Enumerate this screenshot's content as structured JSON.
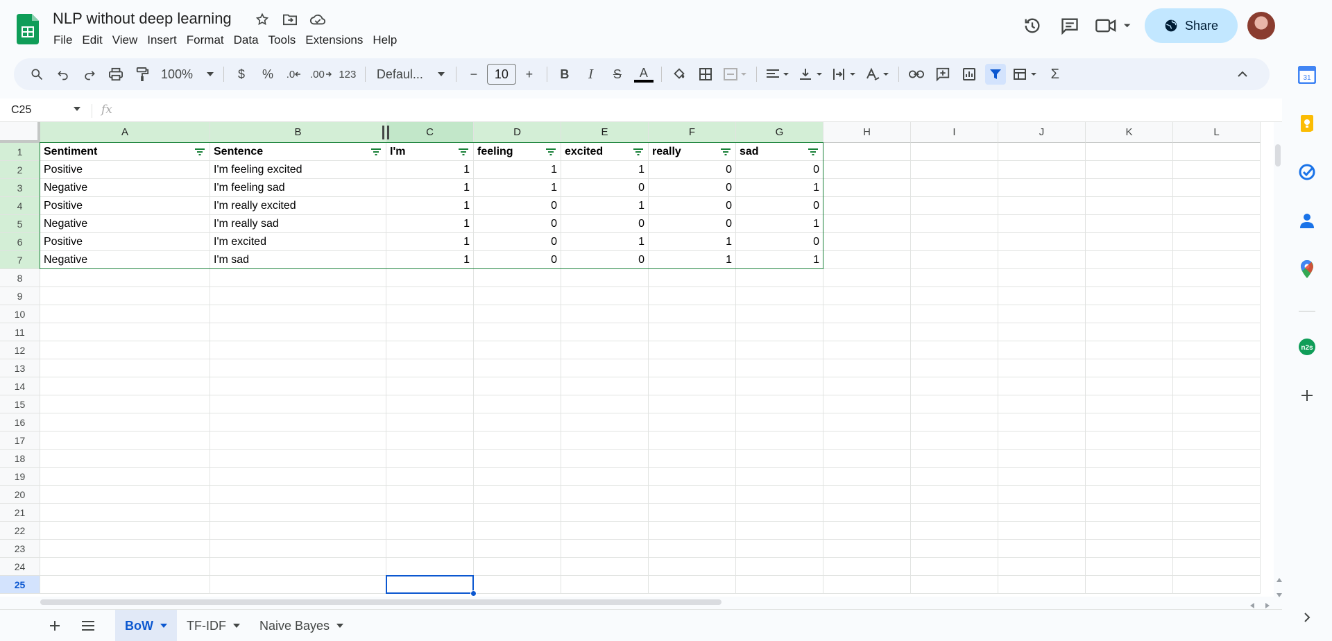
{
  "document": {
    "title": "NLP without deep learning"
  },
  "menu": [
    "File",
    "Edit",
    "View",
    "Insert",
    "Format",
    "Data",
    "Tools",
    "Extensions",
    "Help"
  ],
  "header": {
    "share_label": "Share"
  },
  "toolbar": {
    "zoom": "100%",
    "currency": "$",
    "percent": "%",
    "decrease_decimal": ".0",
    "increase_decimal": ".00",
    "number_format": "123",
    "font": "Defaul...",
    "font_size": "10",
    "minus": "−",
    "plus": "+",
    "bold": "B",
    "italic": "I",
    "strike": "S",
    "text_color": "A",
    "sum": "Σ"
  },
  "formula_bar": {
    "name_box": "C25",
    "fx": "fx",
    "value": ""
  },
  "grid": {
    "columns": [
      "A",
      "B",
      "C",
      "D",
      "E",
      "F",
      "G",
      "H",
      "I",
      "J",
      "K",
      "L"
    ],
    "rows": [
      "1",
      "2",
      "3",
      "4",
      "5",
      "6",
      "7",
      "8",
      "9",
      "10",
      "11",
      "12",
      "13",
      "14",
      "15",
      "16",
      "17",
      "18",
      "19",
      "20",
      "21",
      "22",
      "23",
      "24",
      "25"
    ],
    "header_row": [
      "Sentiment",
      "Sentence",
      "I'm",
      "feeling",
      "excited",
      "really",
      "sad"
    ],
    "data_rows": [
      [
        "Positive",
        "I'm feeling excited",
        "1",
        "1",
        "1",
        "0",
        "0"
      ],
      [
        "Negative",
        "I'm feeling sad",
        "1",
        "1",
        "0",
        "0",
        "1"
      ],
      [
        "Positive",
        "I'm really excited",
        "1",
        "0",
        "1",
        "0",
        "0"
      ],
      [
        "Negative",
        "I'm really sad",
        "1",
        "0",
        "0",
        "0",
        "1"
      ],
      [
        "Positive",
        "I'm excited",
        "1",
        "0",
        "1",
        "1",
        "0"
      ],
      [
        "Negative",
        "I'm sad",
        "1",
        "0",
        "0",
        "1",
        "1"
      ]
    ],
    "active_cell": "C25"
  },
  "sheets": [
    {
      "label": "BoW",
      "active": true
    },
    {
      "label": "TF-IDF",
      "active": false
    },
    {
      "label": "Naive Bayes",
      "active": false
    }
  ],
  "side_panel": {
    "calendar_day": "31",
    "n2s": "n2s"
  },
  "colors": {
    "accent": "#0b57d0",
    "share_bg": "#c2e7ff",
    "table_green": "#188038",
    "sheets_green": "#0f9d58"
  }
}
